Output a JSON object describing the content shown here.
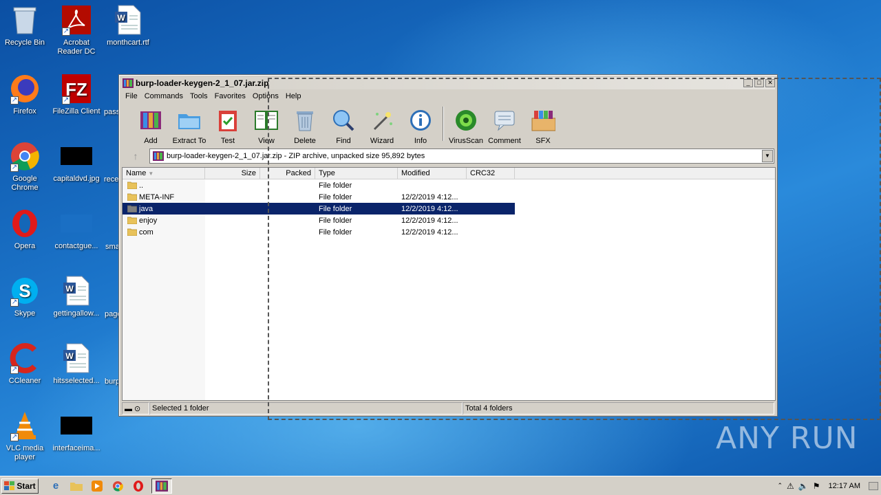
{
  "desktop": {
    "icons": [
      {
        "label": "Recycle Bin",
        "icon": "recycle-bin-icon"
      },
      {
        "label": "Acrobat Reader DC",
        "icon": "acrobat-icon"
      },
      {
        "label": "monthcart.rtf",
        "icon": "word-doc-icon"
      },
      {
        "label": "Firefox",
        "icon": "firefox-icon"
      },
      {
        "label": "FileZilla Client",
        "icon": "filezilla-icon"
      },
      {
        "label": "pass",
        "icon": "black-thumb-icon"
      },
      {
        "label": "Google Chrome",
        "icon": "chrome-icon"
      },
      {
        "label": "capitaldvd.jpg",
        "icon": "image-thumb-icon"
      },
      {
        "label": "rece",
        "icon": "doc-icon"
      },
      {
        "label": "Opera",
        "icon": "opera-icon"
      },
      {
        "label": "contactgue...",
        "icon": "image-thumb-icon"
      },
      {
        "label": "sma",
        "icon": "black-thumb-icon"
      },
      {
        "label": "Skype",
        "icon": "skype-icon"
      },
      {
        "label": "gettingallow...",
        "icon": "word-doc-icon"
      },
      {
        "label": "page",
        "icon": "doc-icon"
      },
      {
        "label": "CCleaner",
        "icon": "ccleaner-icon"
      },
      {
        "label": "hitsselected...",
        "icon": "word-doc-icon"
      },
      {
        "label": "burp",
        "icon": "winrar-icon"
      },
      {
        "label": "VLC media player",
        "icon": "vlc-icon"
      },
      {
        "label": "interfaceima...",
        "icon": "image-thumb-icon"
      }
    ]
  },
  "window": {
    "title": "burp-loader-keygen-2_1_07.jar.zip",
    "menu": [
      "File",
      "Commands",
      "Tools",
      "Favorites",
      "Options",
      "Help"
    ],
    "toolbar": [
      "Add",
      "Extract To",
      "Test",
      "View",
      "Delete",
      "Find",
      "Wizard",
      "Info",
      "VirusScan",
      "Comment",
      "SFX"
    ],
    "address": "burp-loader-keygen-2_1_07.jar.zip - ZIP archive, unpacked size 95,892 bytes",
    "columns": [
      "Name",
      "Size",
      "Packed",
      "Type",
      "Modified",
      "CRC32"
    ],
    "rows": [
      {
        "name": "..",
        "size": "",
        "packed": "",
        "type": "File folder",
        "modified": ""
      },
      {
        "name": "META-INF",
        "size": "",
        "packed": "",
        "type": "File folder",
        "modified": "12/2/2019 4:12..."
      },
      {
        "name": "java",
        "size": "",
        "packed": "",
        "type": "File folder",
        "modified": "12/2/2019 4:12..."
      },
      {
        "name": "enjoy",
        "size": "",
        "packed": "",
        "type": "File folder",
        "modified": "12/2/2019 4:12..."
      },
      {
        "name": "com",
        "size": "",
        "packed": "",
        "type": "File folder",
        "modified": "12/2/2019 4:12..."
      }
    ],
    "selected_row": "java",
    "status_left": "Selected 1 folder",
    "status_right": "Total 4 folders"
  },
  "taskbar": {
    "start": "Start",
    "clock": "12:17 AM"
  },
  "watermark": "ANY RUN",
  "colors": {
    "selection": "#0a246a",
    "desktop": "#1467b8"
  }
}
